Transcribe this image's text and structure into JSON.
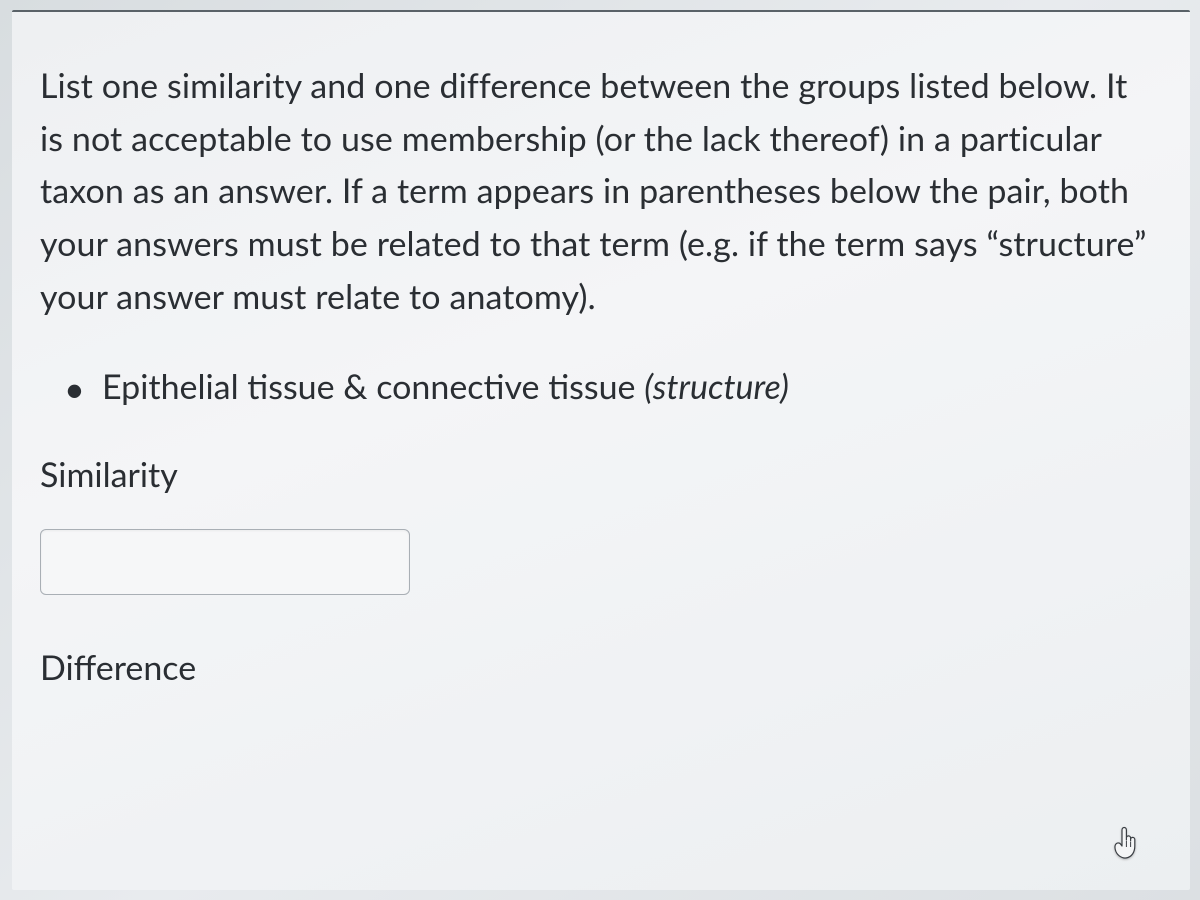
{
  "question": {
    "prompt": "List one similarity and one difference between the groups listed below. It is not acceptable to use membership (or the lack thereof) in a particular taxon as an answer. If a term appears in parentheses below the pair, both your answers must be related to that term (e.g. if the term says “structure” your answer must relate to anatomy).",
    "bullet_main": "Epithelial tissue & connective tissue ",
    "bullet_paren": "(structure)"
  },
  "fields": {
    "similarity_label": "Similarity",
    "similarity_value": "",
    "difference_label": "Difference"
  }
}
